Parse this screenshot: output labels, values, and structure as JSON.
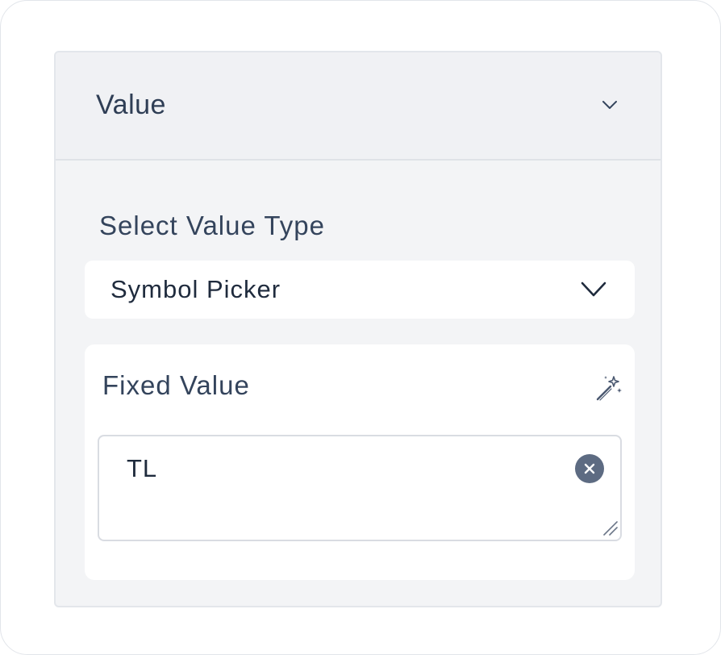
{
  "panel": {
    "title": "Value",
    "collapse_icon": "chevron-down-icon"
  },
  "value_type": {
    "label": "Select Value Type",
    "selected": "Symbol Picker",
    "dropdown_icon": "chevron-down-icon"
  },
  "fixed_value": {
    "label": "Fixed Value",
    "magic_icon": "magic-wand-icon",
    "value": "TL",
    "clear_icon": "clear-circle-icon"
  },
  "colors": {
    "text_primary": "#1f2b3d",
    "text_label": "#34445c",
    "clear_button": "#5d6b82",
    "panel_bg": "#f3f4f6"
  }
}
